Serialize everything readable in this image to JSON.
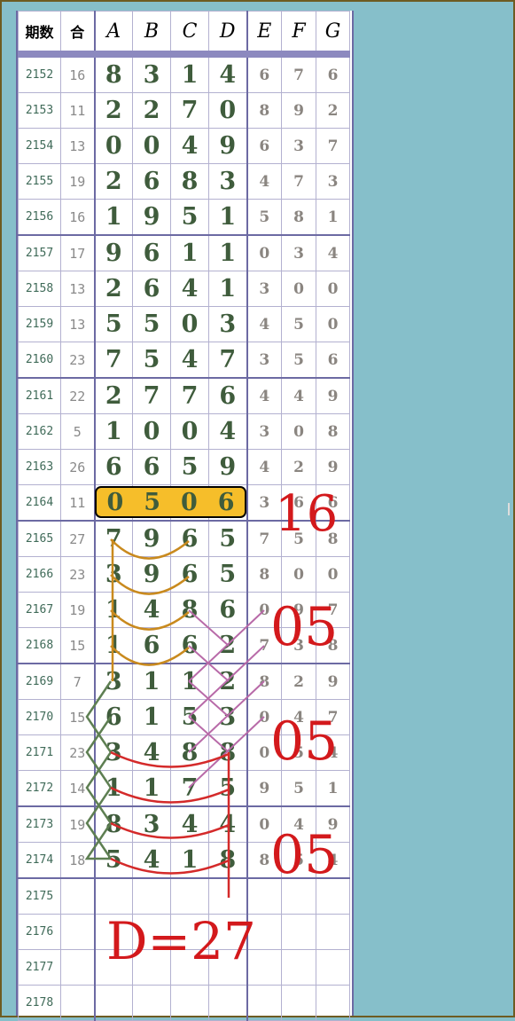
{
  "header": [
    "期数",
    "合",
    "A",
    "B",
    "C",
    "D",
    "E",
    "F",
    "G"
  ],
  "rows": [
    {
      "period": "2152",
      "sum": "16",
      "a": "8",
      "b": "3",
      "c": "1",
      "d": "4",
      "e": "6",
      "f": "7",
      "g": "6"
    },
    {
      "period": "2153",
      "sum": "11",
      "a": "2",
      "b": "2",
      "c": "7",
      "d": "0",
      "e": "8",
      "f": "9",
      "g": "2"
    },
    {
      "period": "2154",
      "sum": "13",
      "a": "0",
      "b": "0",
      "c": "4",
      "d": "9",
      "e": "6",
      "f": "3",
      "g": "7"
    },
    {
      "period": "2155",
      "sum": "19",
      "a": "2",
      "b": "6",
      "c": "8",
      "d": "3",
      "e": "4",
      "f": "7",
      "g": "3"
    },
    {
      "period": "2156",
      "sum": "16",
      "a": "1",
      "b": "9",
      "c": "5",
      "d": "1",
      "e": "5",
      "f": "8",
      "g": "1"
    },
    {
      "period": "2157",
      "sum": "17",
      "a": "9",
      "b": "6",
      "c": "1",
      "d": "1",
      "e": "0",
      "f": "3",
      "g": "4"
    },
    {
      "period": "2158",
      "sum": "13",
      "a": "2",
      "b": "6",
      "c": "4",
      "d": "1",
      "e": "3",
      "f": "0",
      "g": "0"
    },
    {
      "period": "2159",
      "sum": "13",
      "a": "5",
      "b": "5",
      "c": "0",
      "d": "3",
      "e": "4",
      "f": "5",
      "g": "0"
    },
    {
      "period": "2160",
      "sum": "23",
      "a": "7",
      "b": "5",
      "c": "4",
      "d": "7",
      "e": "3",
      "f": "5",
      "g": "6"
    },
    {
      "period": "2161",
      "sum": "22",
      "a": "2",
      "b": "7",
      "c": "7",
      "d": "6",
      "e": "4",
      "f": "4",
      "g": "9"
    },
    {
      "period": "2162",
      "sum": "5",
      "a": "1",
      "b": "0",
      "c": "0",
      "d": "4",
      "e": "3",
      "f": "0",
      "g": "8"
    },
    {
      "period": "2163",
      "sum": "26",
      "a": "6",
      "b": "6",
      "c": "5",
      "d": "9",
      "e": "4",
      "f": "2",
      "g": "9"
    },
    {
      "period": "2164",
      "sum": "11",
      "a": "0",
      "b": "5",
      "c": "0",
      "d": "6",
      "e": "3",
      "f": "6",
      "g": "6"
    },
    {
      "period": "2165",
      "sum": "27",
      "a": "7",
      "b": "9",
      "c": "6",
      "d": "5",
      "e": "7",
      "f": "5",
      "g": "8"
    },
    {
      "period": "2166",
      "sum": "23",
      "a": "3",
      "b": "9",
      "c": "6",
      "d": "5",
      "e": "8",
      "f": "0",
      "g": "0"
    },
    {
      "period": "2167",
      "sum": "19",
      "a": "1",
      "b": "4",
      "c": "8",
      "d": "6",
      "e": "0",
      "f": "9",
      "g": "7"
    },
    {
      "period": "2168",
      "sum": "15",
      "a": "1",
      "b": "6",
      "c": "6",
      "d": "2",
      "e": "7",
      "f": "3",
      "g": "8"
    },
    {
      "period": "2169",
      "sum": "7",
      "a": "3",
      "b": "1",
      "c": "1",
      "d": "2",
      "e": "8",
      "f": "2",
      "g": "9"
    },
    {
      "period": "2170",
      "sum": "15",
      "a": "6",
      "b": "1",
      "c": "5",
      "d": "3",
      "e": "0",
      "f": "4",
      "g": "7"
    },
    {
      "period": "2171",
      "sum": "23",
      "a": "3",
      "b": "4",
      "c": "8",
      "d": "8",
      "e": "0",
      "f": "5",
      "g": "4"
    },
    {
      "period": "2172",
      "sum": "14",
      "a": "1",
      "b": "1",
      "c": "7",
      "d": "5",
      "e": "9",
      "f": "5",
      "g": "1"
    },
    {
      "period": "2173",
      "sum": "19",
      "a": "8",
      "b": "3",
      "c": "4",
      "d": "4",
      "e": "0",
      "f": "4",
      "g": "9"
    },
    {
      "period": "2174",
      "sum": "18",
      "a": "5",
      "b": "4",
      "c": "1",
      "d": "8",
      "e": "8",
      "f": "5",
      "g": "4"
    },
    {
      "period": "2175",
      "sum": "",
      "a": "",
      "b": "",
      "c": "",
      "d": "",
      "e": "",
      "f": "",
      "g": ""
    },
    {
      "period": "2176",
      "sum": "",
      "a": "",
      "b": "",
      "c": "",
      "d": "",
      "e": "",
      "f": "",
      "g": ""
    },
    {
      "period": "2177",
      "sum": "",
      "a": "",
      "b": "",
      "c": "",
      "d": "",
      "e": "",
      "f": "",
      "g": ""
    },
    {
      "period": "2178",
      "sum": "",
      "a": "",
      "b": "",
      "c": "",
      "d": "",
      "e": "",
      "f": "",
      "g": ""
    }
  ],
  "highlight_row_index": 12,
  "annotations": {
    "a16": "16",
    "a05_1": "05",
    "a05_2": "05",
    "a05_3": "05",
    "d27": "D=27"
  },
  "colors": {
    "accent": "#f6be2a",
    "annotation": "#d3191c",
    "orange_curve": "#c98a1e",
    "red_curve": "#d42a2a",
    "purple_line": "#b86aa8",
    "green_line": "#5e7f52"
  }
}
